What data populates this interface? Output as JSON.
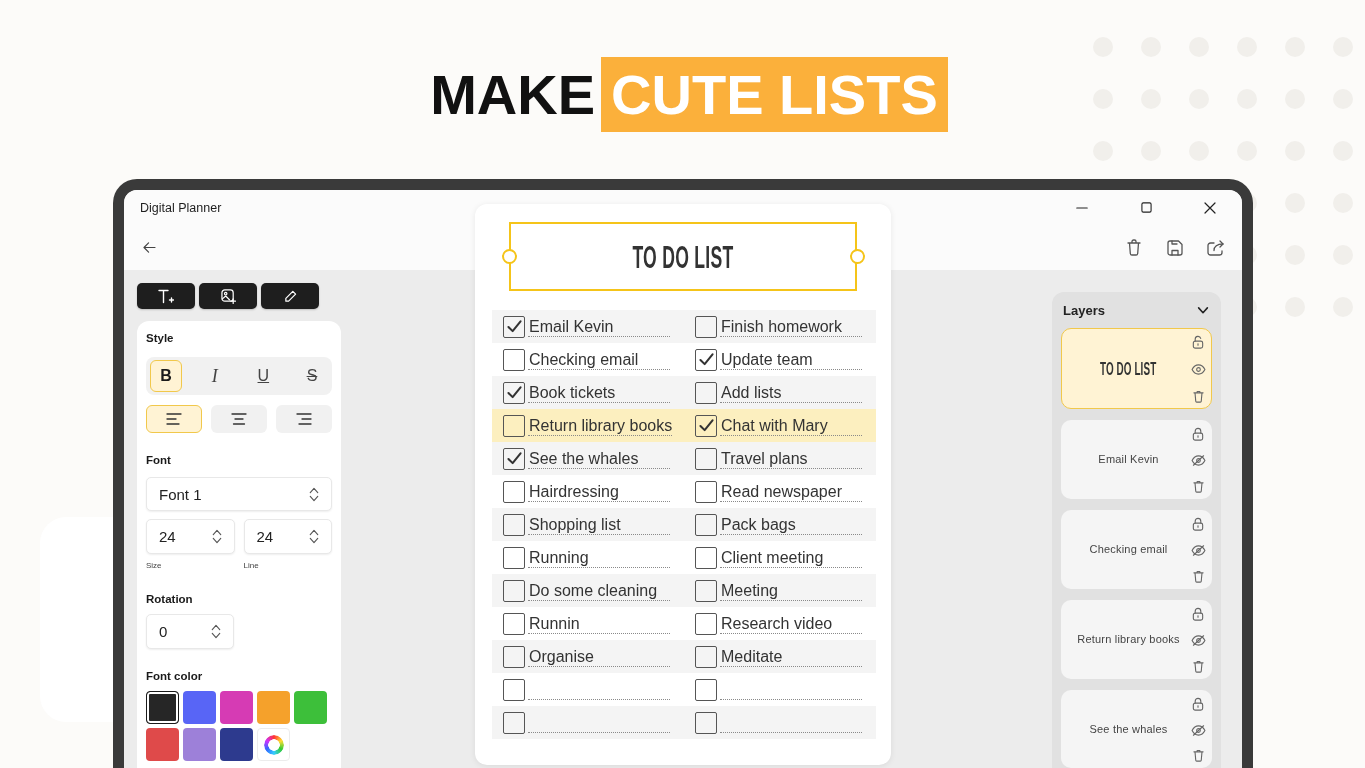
{
  "headline": [
    {
      "text": "MAKE",
      "highlighted": false
    },
    {
      "text": "CUTE LISTS",
      "highlighted": true
    }
  ],
  "window": {
    "title": "Digital Planner"
  },
  "style_panel": {
    "style_heading": "Style",
    "text_styles": [
      {
        "label": "B",
        "kind": "bold",
        "selected": true
      },
      {
        "label": "I",
        "kind": "italic",
        "selected": false
      },
      {
        "label": "U",
        "kind": "underline",
        "selected": false
      },
      {
        "label": "S",
        "kind": "strikethrough",
        "selected": false
      }
    ],
    "alignments": [
      {
        "kind": "left",
        "selected": true
      },
      {
        "kind": "center",
        "selected": false
      },
      {
        "kind": "right",
        "selected": false
      }
    ],
    "font_heading": "Font",
    "font": "Font 1",
    "fields": [
      {
        "value": "24",
        "label": "Size"
      },
      {
        "value": "24",
        "label": "Line"
      }
    ],
    "rotation_heading": "Rotation",
    "rotation": "0",
    "color_heading": "Font color",
    "colors": [
      {
        "kind": "swatch",
        "color": "#262626",
        "selected": true
      },
      {
        "kind": "swatch",
        "color": "#5865f6",
        "selected": false
      },
      {
        "kind": "swatch",
        "color": "#d63bb4",
        "selected": false
      },
      {
        "kind": "swatch",
        "color": "#f5a12b",
        "selected": false
      },
      {
        "kind": "swatch",
        "color": "#3dbf3a",
        "selected": false
      },
      {
        "kind": "swatch",
        "color": "#df4a4a",
        "selected": false
      },
      {
        "kind": "swatch",
        "color": "#9d80d9",
        "selected": false
      },
      {
        "kind": "swatch",
        "color": "#2d3a8e",
        "selected": false
      },
      {
        "kind": "picker",
        "selected": false
      }
    ]
  },
  "todo": {
    "title": "TO DO LIST",
    "rows": [
      {
        "highlighted": false,
        "items": [
          {
            "text": "Email Kevin",
            "checked": true
          },
          {
            "text": "Finish homework",
            "checked": false
          }
        ]
      },
      {
        "highlighted": false,
        "items": [
          {
            "text": "Checking email",
            "checked": false
          },
          {
            "text": "Update team",
            "checked": true
          }
        ]
      },
      {
        "highlighted": false,
        "items": [
          {
            "text": "Book tickets",
            "checked": true
          },
          {
            "text": "Add lists",
            "checked": false
          }
        ]
      },
      {
        "highlighted": true,
        "items": [
          {
            "text": "Return library books",
            "checked": false
          },
          {
            "text": "Chat with Mary",
            "checked": true
          }
        ]
      },
      {
        "highlighted": false,
        "items": [
          {
            "text": "See the whales",
            "checked": true
          },
          {
            "text": "Travel plans",
            "checked": false
          }
        ]
      },
      {
        "highlighted": false,
        "items": [
          {
            "text": "Hairdressing",
            "checked": false
          },
          {
            "text": "Read newspaper",
            "checked": false
          }
        ]
      },
      {
        "highlighted": false,
        "items": [
          {
            "text": "Shopping list",
            "checked": false
          },
          {
            "text": "Pack bags",
            "checked": false
          }
        ]
      },
      {
        "highlighted": false,
        "items": [
          {
            "text": "Running",
            "checked": false
          },
          {
            "text": "Client meeting",
            "checked": false
          }
        ]
      },
      {
        "highlighted": false,
        "items": [
          {
            "text": "Do some cleaning",
            "checked": false
          },
          {
            "text": "Meeting",
            "checked": false
          }
        ]
      },
      {
        "highlighted": false,
        "items": [
          {
            "text": "Runnin",
            "checked": false
          },
          {
            "text": "Research video",
            "checked": false
          }
        ]
      },
      {
        "highlighted": false,
        "items": [
          {
            "text": "Organise",
            "checked": false
          },
          {
            "text": "Meditate",
            "checked": false
          }
        ]
      },
      {
        "highlighted": false,
        "items": [
          {
            "checked": false
          },
          {
            "checked": false
          }
        ]
      },
      {
        "highlighted": false,
        "items": [
          {
            "checked": false
          },
          {
            "checked": false
          }
        ]
      }
    ]
  },
  "layers": {
    "title": "Layers",
    "expanded": true,
    "items": [
      {
        "label": "TO DO LIST",
        "kind": "title",
        "selected": true,
        "locked": false,
        "visible": true
      },
      {
        "label": "Email Kevin",
        "kind": "text",
        "selected": false,
        "locked": true,
        "visible": false
      },
      {
        "label": "Checking email",
        "kind": "text",
        "selected": false,
        "locked": true,
        "visible": false
      },
      {
        "label": "Return library books",
        "kind": "text",
        "selected": false,
        "locked": true,
        "visible": false
      },
      {
        "label": "See the whales",
        "kind": "text",
        "selected": false,
        "locked": true,
        "visible": false
      }
    ]
  }
}
